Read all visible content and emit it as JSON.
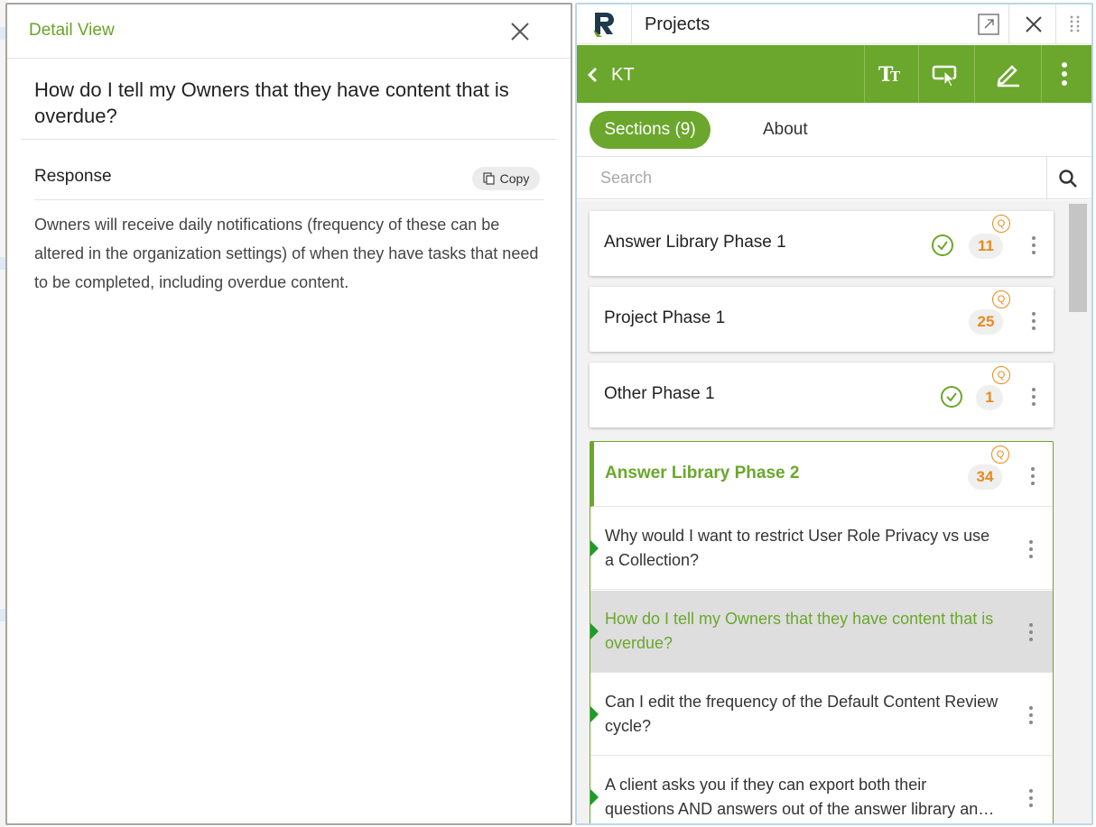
{
  "detail": {
    "title": "Detail View",
    "close_icon": "close-icon",
    "question": "How do I tell my Owners that they have content that is overdue?",
    "response_label": "Response",
    "copy_label": "Copy",
    "response_text": "Owners will receive daily notifications (frequency of these can be altered in the organization settings) of when they have tasks that need to be completed, including overdue content."
  },
  "panel": {
    "app_title": "Projects",
    "icons": [
      "logo-icon",
      "popout-icon",
      "close-icon",
      "drag-handle-icon"
    ],
    "project_name": "KT",
    "toolbar_icons": [
      "text-size-icon",
      "select-icon",
      "edit-icon",
      "more-vertical-icon"
    ],
    "tabs": {
      "active": "Sections (9)",
      "other": "About"
    },
    "search": {
      "placeholder": "Search"
    },
    "sections": [
      {
        "title": "Answer Library Phase 1",
        "count": "11",
        "q_label": "Q",
        "complete": true
      },
      {
        "title": "Project Phase 1",
        "count": "25",
        "q_label": "Q",
        "complete": false
      },
      {
        "title": "Other Phase 1",
        "count": "1",
        "q_label": "Q",
        "complete": true
      }
    ],
    "expanded_section": {
      "title": "Answer Library Phase 2",
      "count": "34",
      "q_label": "Q",
      "questions": [
        {
          "text": "Why would I want to restrict User Role Privacy vs use a Collection?"
        },
        {
          "text": "How do I tell my Owners that they have content that is overdue?",
          "selected": true
        },
        {
          "text": "Can I edit the frequency of the Default Content Review cycle?"
        },
        {
          "line1": "A client asks you if they can export both their",
          "line2": "questions AND answers out of the answer library and into a spreadsheet?"
        }
      ]
    },
    "colors": {
      "brand_green": "#6aa72c",
      "count_orange": "#e98a1a",
      "marker_green": "#1f9a2c"
    }
  }
}
